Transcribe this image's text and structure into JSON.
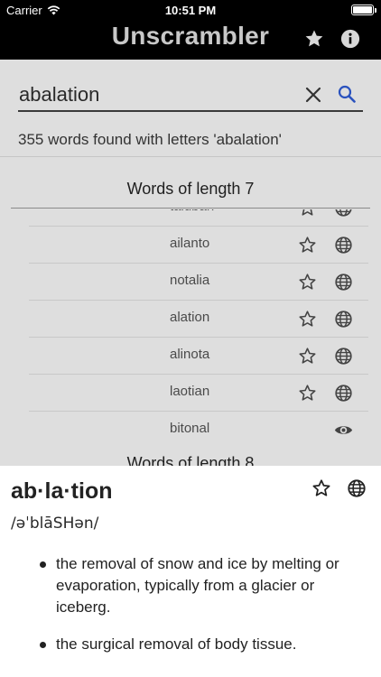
{
  "status_bar": {
    "carrier": "Carrier",
    "time": "10:51 PM"
  },
  "nav": {
    "title": "Unscrambler",
    "star_icon": "star-filled-icon",
    "info_icon": "info-icon"
  },
  "search": {
    "value": "abalation",
    "placeholder": ""
  },
  "results": {
    "summary": "355 words found with letters 'abalation'"
  },
  "sections": [
    {
      "title": "Words of length 7",
      "words": [
        {
          "text": "taluban",
          "fav_icon": "star-outline-icon",
          "action_icon": "globe-icon"
        },
        {
          "text": "ailanto",
          "fav_icon": "star-outline-icon",
          "action_icon": "globe-icon"
        },
        {
          "text": "notalia",
          "fav_icon": "star-outline-icon",
          "action_icon": "globe-icon"
        },
        {
          "text": "alation",
          "fav_icon": "star-outline-icon",
          "action_icon": "globe-icon"
        },
        {
          "text": "alinota",
          "fav_icon": "star-outline-icon",
          "action_icon": "globe-icon"
        },
        {
          "text": "laotian",
          "fav_icon": "star-outline-icon",
          "action_icon": "globe-icon"
        },
        {
          "text": "bitonal",
          "fav_icon": "",
          "action_icon": "eye-icon"
        }
      ]
    },
    {
      "title": "Words of length 8"
    }
  ],
  "definition": {
    "word": "ab·la·tion",
    "pronunciation": "/əˈblāSHən/",
    "meanings": [
      "the removal of snow and ice by melting or evaporation, typically from a glacier or iceberg.",
      "the surgical removal of body tissue."
    ]
  },
  "colors": {
    "bar": "#000000",
    "accent": "#2a52be",
    "dim_overlay": "#dedede"
  }
}
